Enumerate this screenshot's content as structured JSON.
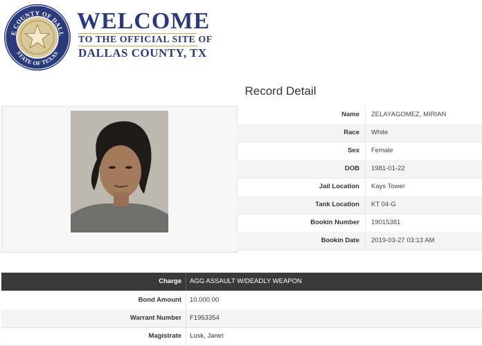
{
  "header": {
    "seal_top_text": "THE COUNTY OF DALLAS",
    "seal_bottom_text": "STATE OF TEXAS",
    "welcome": "WELCOME",
    "subtitle_line1": "TO THE OFFICIAL SITE OF",
    "subtitle_line2": "DALLAS COUNTY, TX",
    "brand_color": "#2b3a7a",
    "accent_color": "#c9a84a"
  },
  "page_title": "Record Detail",
  "record": {
    "photo_icon": "mugshot-photo",
    "fields": [
      {
        "label": "Name",
        "value": "ZELAYAGOMEZ, MIRIAN"
      },
      {
        "label": "Race",
        "value": "White"
      },
      {
        "label": "Sex",
        "value": "Female"
      },
      {
        "label": "DOB",
        "value": "1981-01-22"
      },
      {
        "label": "Jail Location",
        "value": "Kays Tower"
      },
      {
        "label": "Tank Location",
        "value": "KT 04-G"
      },
      {
        "label": "Bookin Number",
        "value": "19015381"
      },
      {
        "label": "Bookin Date",
        "value": "2019-03-27 03:13 AM"
      }
    ]
  },
  "charges": {
    "header": {
      "label": "Charge",
      "value": "AGG ASSAULT W/DEADLY WEAPON"
    },
    "rows": [
      {
        "label": "Bond Amount",
        "value": "10,000.00"
      },
      {
        "label": "Warrant Number",
        "value": "F1953354"
      },
      {
        "label": "Magistrate",
        "value": "Lusk, Janet"
      }
    ]
  }
}
